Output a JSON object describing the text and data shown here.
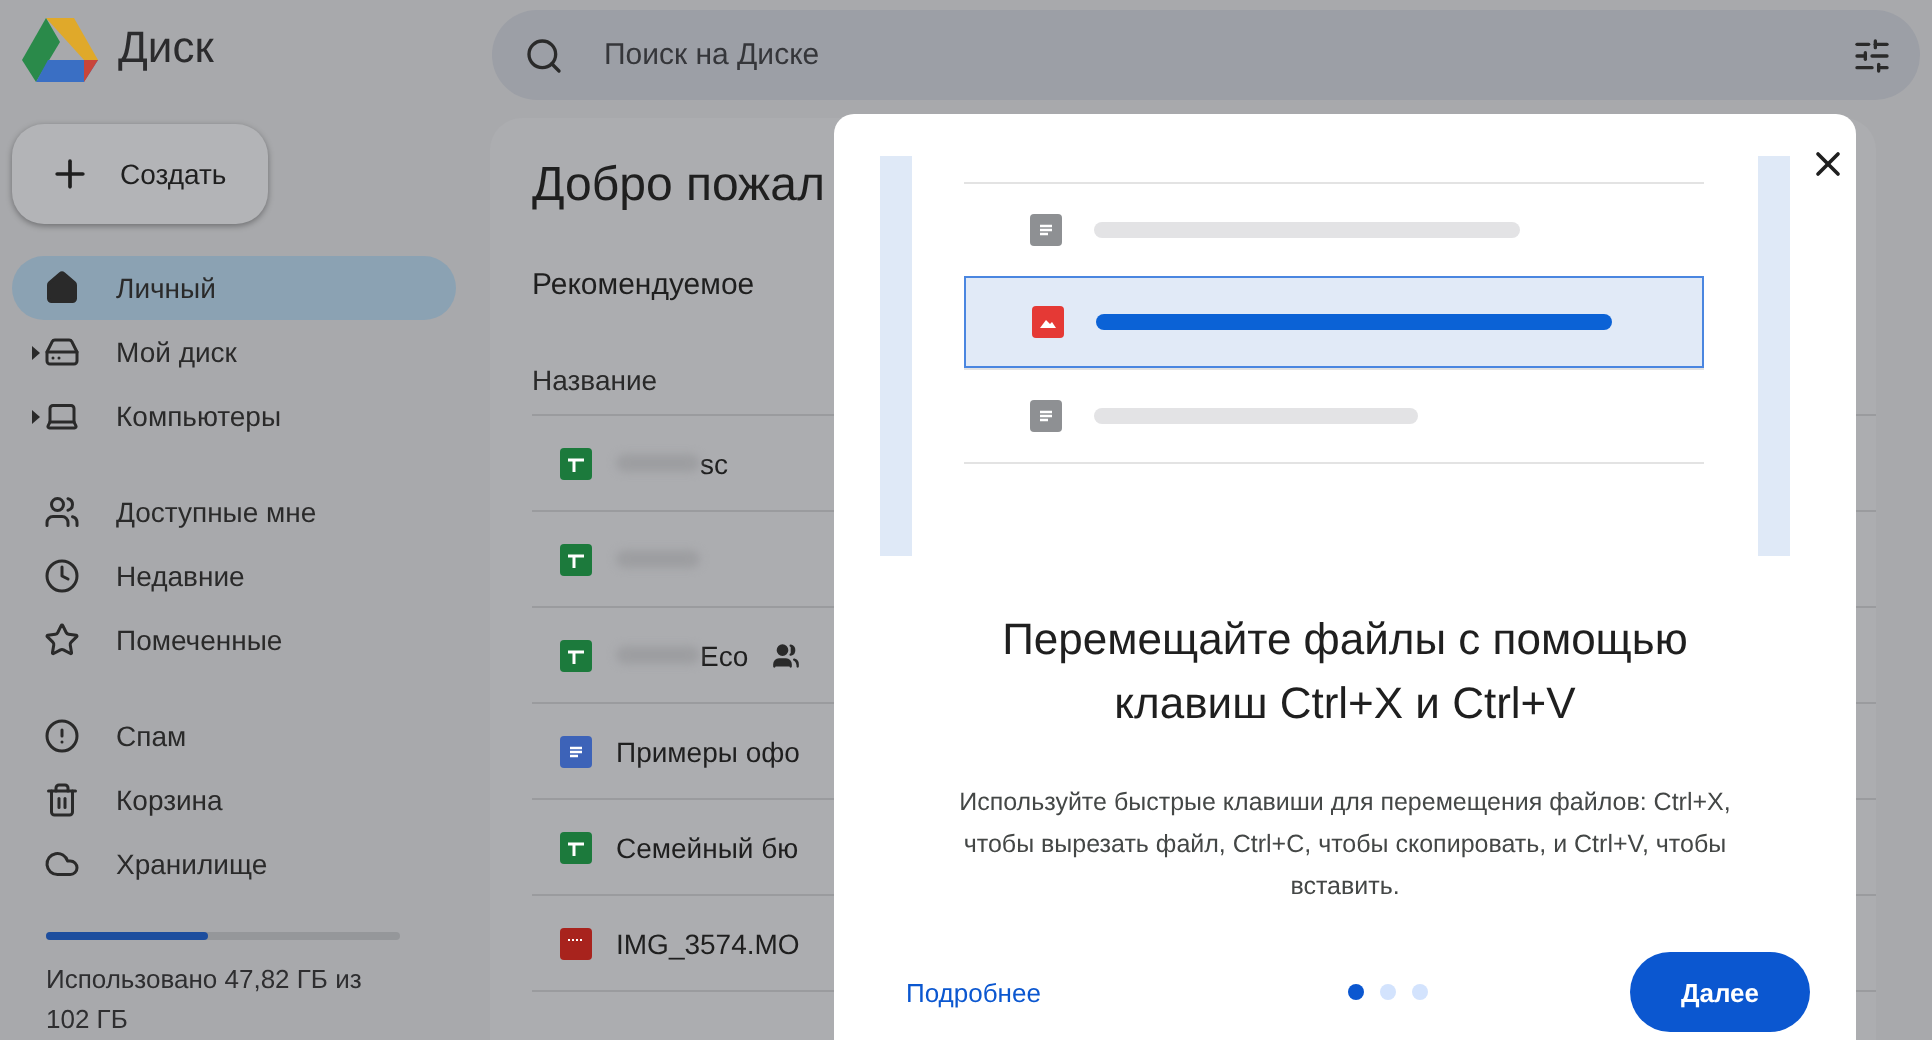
{
  "app": {
    "title": "Диск"
  },
  "search": {
    "placeholder": "Поиск на Диске"
  },
  "create_button": "Создать",
  "nav_groups": [
    [
      {
        "label": "Личный",
        "selected": true,
        "expandable": false
      },
      {
        "label": "Мой диск",
        "selected": false,
        "expandable": true
      },
      {
        "label": "Компьютеры",
        "selected": false,
        "expandable": true
      }
    ],
    [
      {
        "label": "Доступные мне",
        "selected": false,
        "expandable": false
      },
      {
        "label": "Недавние",
        "selected": false,
        "expandable": false
      },
      {
        "label": "Помеченные",
        "selected": false,
        "expandable": false
      }
    ],
    [
      {
        "label": "Спам",
        "selected": false,
        "expandable": false
      },
      {
        "label": "Корзина",
        "selected": false,
        "expandable": false
      },
      {
        "label": "Хранилище",
        "selected": false,
        "expandable": false
      }
    ]
  ],
  "storage": {
    "level": 0.46,
    "text": "Использовано 47,82 ГБ из 102 ГБ"
  },
  "main": {
    "heading": "Добро пожал",
    "filter_label": "Рекомендуемое",
    "column": "Название",
    "rows": [
      {
        "kind": "sheet",
        "blurred": true,
        "name": "sc",
        "shared": false
      },
      {
        "kind": "sheet",
        "blurred": true,
        "shared": false
      },
      {
        "kind": "sheet",
        "blurred": true,
        "name": "Eco",
        "shared": true
      },
      {
        "kind": "doc",
        "blurred": false,
        "name": "Примеры офо",
        "shared": false
      },
      {
        "kind": "sheet",
        "blurred": false,
        "name": "Семейный бю",
        "shared": false
      },
      {
        "kind": "video",
        "blurred": false,
        "name": "IMG_3574.MO",
        "shared": false
      }
    ]
  },
  "dialog": {
    "title": "Перемещайте файлы с помощью клавиш Ctrl+X и Ctrl+V",
    "body": "Используйте быстрые клавиши для перемещения файлов: Ctrl+X, чтобы вырезать файл, Ctrl+C, чтобы скопировать, и Ctrl+V, чтобы вставить.",
    "link": "Подробнее",
    "next_button": "Далее",
    "dots": [
      {
        "selected": true
      },
      {
        "selected": false
      },
      {
        "selected": false
      }
    ]
  }
}
